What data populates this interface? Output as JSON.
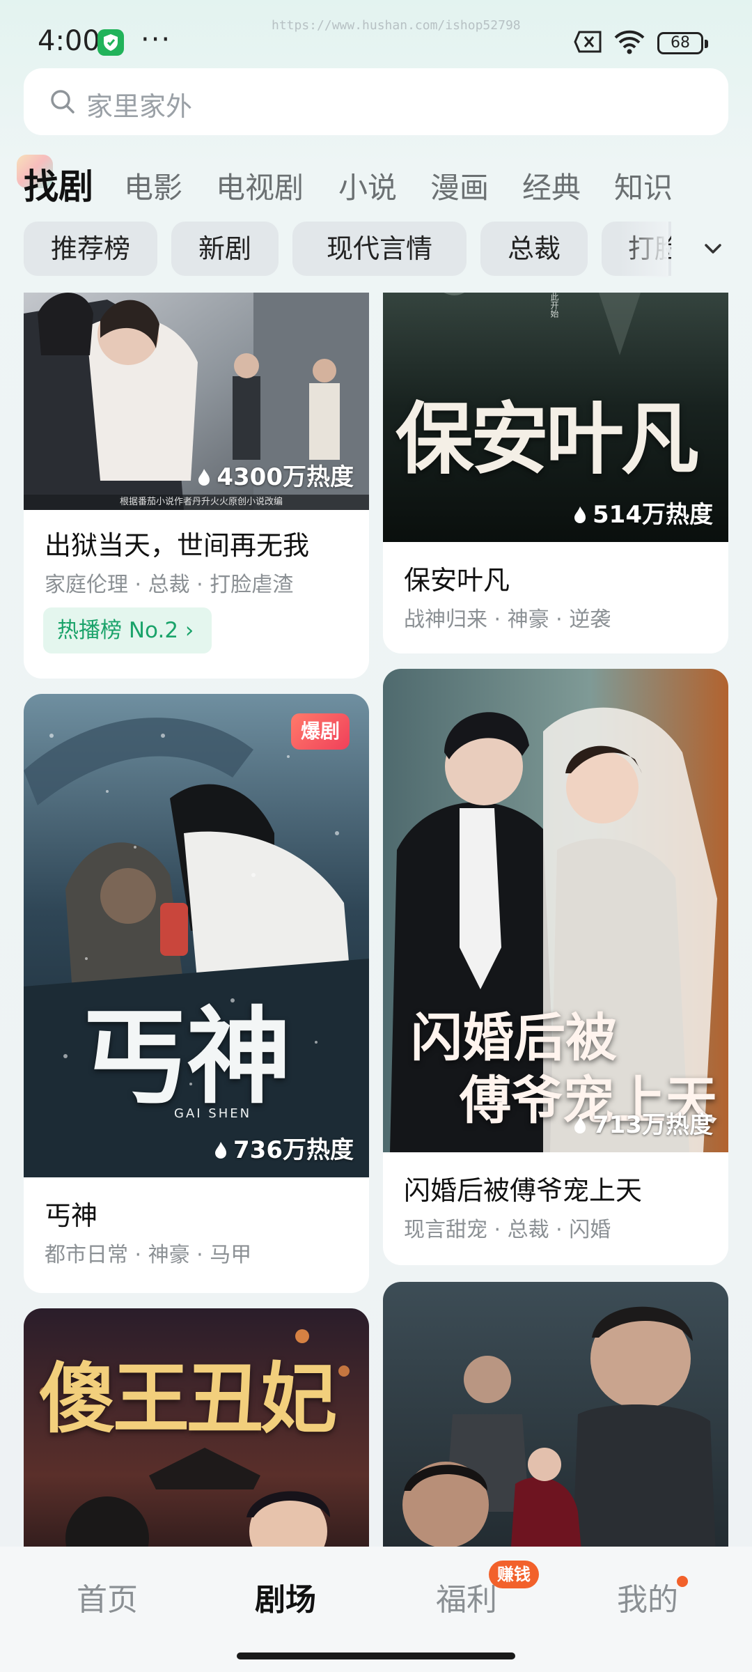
{
  "status_bar": {
    "time": "4:00",
    "watermark": "https://www.hushan.com/ishop52798",
    "battery": "68"
  },
  "search": {
    "placeholder": "家里家外"
  },
  "top_tabs": [
    "找剧",
    "电影",
    "电视剧",
    "小说",
    "漫画",
    "经典",
    "知识"
  ],
  "active_tab": "找剧",
  "filter_chips": [
    "推荐榜",
    "新剧",
    "现代言情",
    "总裁",
    "打脸"
  ],
  "cards": [
    {
      "title": "出狱当天，世间再无我",
      "tags": "家庭伦理 · 总裁 · 打脸虐渣",
      "heat": "4300万热度",
      "poster_credit": "根据番茄小说作者丹升火火原创小说改编",
      "rank_badge": "热播榜 No.2 ›"
    },
    {
      "title": "保安叶凡",
      "tags": "战神归来 · 神豪 · 逆袭",
      "heat": "514万热度",
      "poster_title": "保安叶凡",
      "poster_subtitle": "此开始"
    },
    {
      "title": "丐神",
      "tags": "都市日常 · 神豪 · 马甲",
      "heat": "736万热度",
      "badge": "爆剧",
      "poster_title": "丐神",
      "poster_subtitle": "GAI SHEN"
    },
    {
      "title": "闪婚后被傅爷宠上天",
      "tags": "现言甜宠 · 总裁 · 闪婚",
      "heat": "713万热度",
      "poster_title_line1": "闪婚后被",
      "poster_title_line2": "傅爷宠上天"
    },
    {
      "poster_title": "傻王丑妃"
    },
    {}
  ],
  "bottom_nav": {
    "items": [
      "首页",
      "剧场",
      "福利",
      "我的"
    ],
    "active": "剧场",
    "earn_badge": "赚钱"
  },
  "colors": {
    "accent_green": "#1aa36a",
    "badge_orange": "#f2612b",
    "hot_badge_red": "#f0405a"
  }
}
